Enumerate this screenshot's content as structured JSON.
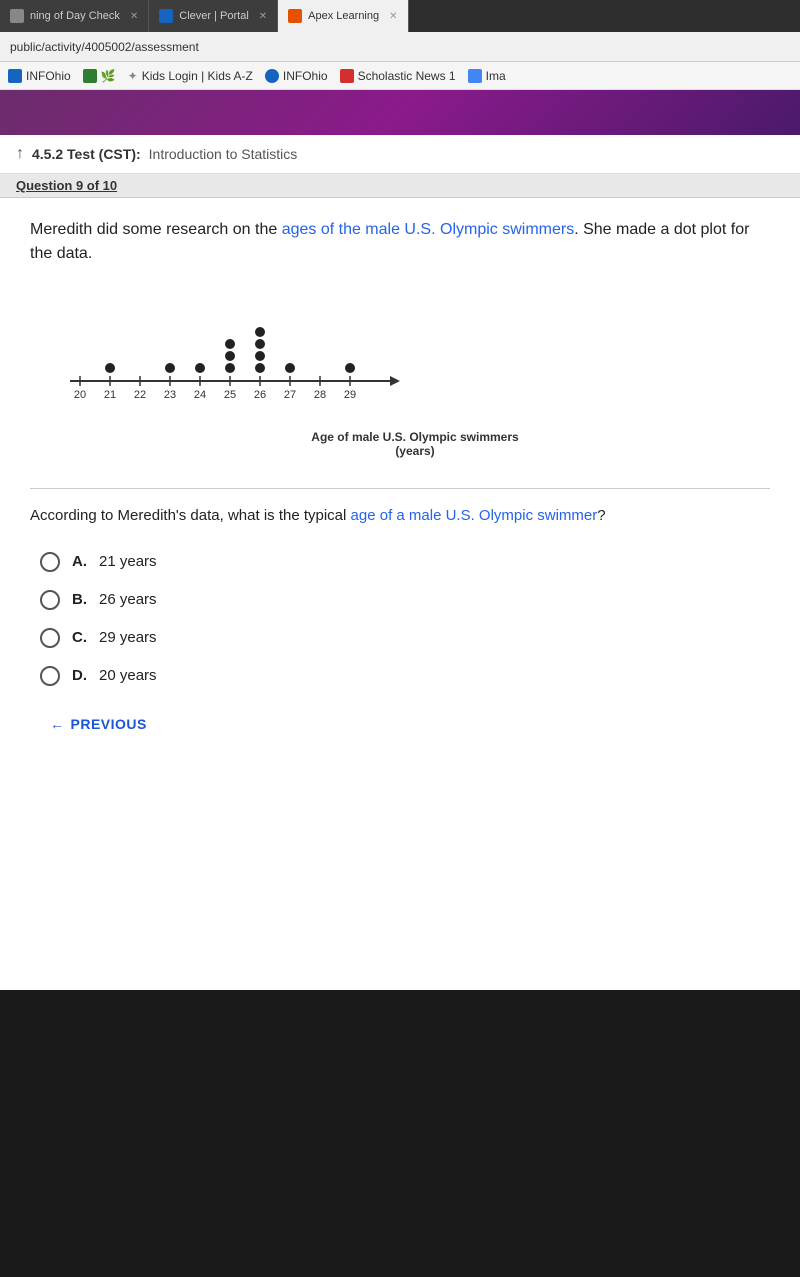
{
  "browser": {
    "tabs": [
      {
        "id": "tab1",
        "label": "ning of Day Check",
        "active": false,
        "favicon": "gray"
      },
      {
        "id": "tab2",
        "label": "Clever | Portal",
        "active": false,
        "favicon": "blue"
      },
      {
        "id": "tab3",
        "label": "Apex Learning",
        "active": true,
        "favicon": "orange"
      }
    ],
    "address": "public/activity/4005002/assessment",
    "bookmarks": [
      {
        "id": "bk1",
        "label": "INFOhio",
        "favicon": "blue"
      },
      {
        "id": "bk2",
        "label": "",
        "favicon": "green"
      },
      {
        "id": "bk3",
        "label": "Kids Login | Kids A-Z",
        "favicon": "gray"
      },
      {
        "id": "bk4",
        "label": "INFOhio",
        "favicon": "blue-circle"
      },
      {
        "id": "bk5",
        "label": "Scholastic News 1",
        "favicon": "red"
      },
      {
        "id": "bk6",
        "label": "Ima",
        "favicon": "google"
      }
    ]
  },
  "header": {
    "test_label": "4.5.2  Test (CST):",
    "test_subtitle": "Introduction to Statistics"
  },
  "question": {
    "counter": "Question 9 of 10",
    "stem_part1": "Meredith did some research on the ",
    "stem_highlight1": "ages of the male U.S. Olympic swimmers",
    "stem_part2": ". She made a dot plot for the data.",
    "dot_plot": {
      "x_min": 20,
      "x_max": 29,
      "x_labels": [
        "20",
        "21",
        "22",
        "23",
        "24",
        "25",
        "26",
        "27",
        "28",
        "29"
      ],
      "dots": [
        {
          "x": 21,
          "count": 1
        },
        {
          "x": 23,
          "count": 1
        },
        {
          "x": 24,
          "count": 1
        },
        {
          "x": 25,
          "count": 3
        },
        {
          "x": 26,
          "count": 4
        },
        {
          "x": 27,
          "count": 1
        },
        {
          "x": 29,
          "count": 1
        }
      ],
      "axis_label_line1": "Age of male U.S. Olympic swimmers",
      "axis_label_line2": "(years)"
    },
    "followup_part1": "According to Meredith's data, what is the typical ",
    "followup_highlight": "age of a male U.S. Olympic swimmer",
    "followup_part2": "?",
    "choices": [
      {
        "id": "A",
        "label": "A.",
        "text": "21 years"
      },
      {
        "id": "B",
        "label": "B.",
        "text": "26 years"
      },
      {
        "id": "C",
        "label": "C.",
        "text": "29 years"
      },
      {
        "id": "D",
        "label": "D.",
        "text": "20 years"
      }
    ]
  },
  "navigation": {
    "previous_label": "PREVIOUS"
  }
}
